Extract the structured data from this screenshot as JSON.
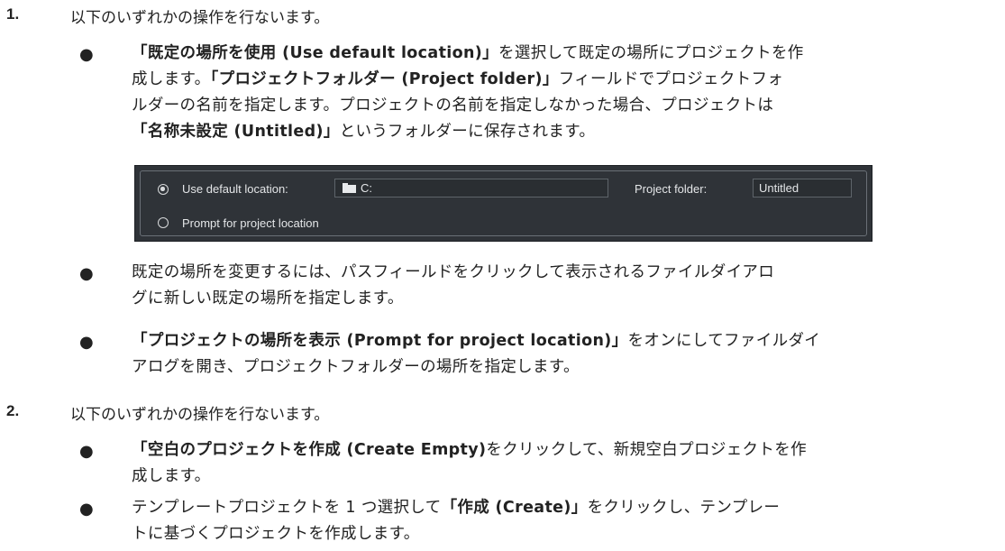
{
  "steps": [
    {
      "number": "1.",
      "text": "以下のいずれかの操作を行ないます。"
    },
    {
      "number": "2.",
      "text": "以下のいずれかの操作を行ないます。"
    }
  ],
  "bullet_symbol": "●",
  "step1_bullets": {
    "b1": {
      "b1": "「既定の場所を使用 (Use default location)」",
      "t1": "を選択して既定の場所にプロジェクトを作",
      "t2": "成します。",
      "b2": "「プロジェクトフォルダー (Project folder)」",
      "t3": "フィールドでプロジェクトフォ",
      "t4": "ルダーの名前を指定します。プロジェクトの名前を指定しなかった場合、プロジェクトは",
      "b3": "「名称未設定 (Untitled)」",
      "t5": "というフォルダーに保存されます。"
    },
    "b2": {
      "line1": "既定の場所を変更するには、パスフィールドをクリックして表示されるファイルダイアロ",
      "line2": "グに新しい既定の場所を指定します。"
    },
    "b3": {
      "b1": "「プロジェクトの場所を表示 (Prompt for project location)」",
      "t1": "をオンにしてファイルダイ",
      "t2": "アログを開き、プロジェクトフォルダーの場所を指定します。"
    }
  },
  "step2_bullets": {
    "b1": {
      "b1": "「空白のプロジェクトを作成 (Create Empty)",
      "t1": "をクリックして、新規空白プロジェクトを作",
      "t2": "成します。"
    },
    "b2": {
      "t1": "テンプレートプロジェクトを 1 つ選択して",
      "b1": "「作成 (Create)」",
      "t2": "をクリックし、テンプレー",
      "t3": "トに基づくプロジェクトを作成します。"
    }
  },
  "dialog": {
    "use_default_label": "Use default location:",
    "path_value": "C:",
    "project_folder_label": "Project folder:",
    "project_folder_value": "Untitled",
    "prompt_label": "Prompt for project location",
    "selected_option": "use_default_location"
  }
}
